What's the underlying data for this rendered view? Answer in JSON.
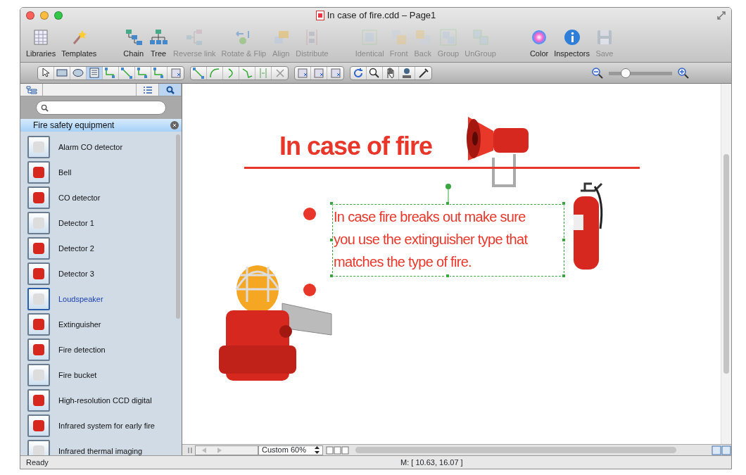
{
  "window": {
    "title": "In case of fire.cdd – Page1"
  },
  "toolbar": [
    {
      "label": "Libraries",
      "kind": "libraries",
      "enabled": true
    },
    {
      "label": "Templates",
      "kind": "templates",
      "enabled": true
    },
    {
      "label": "Chain",
      "kind": "chain",
      "enabled": true
    },
    {
      "label": "Tree",
      "kind": "tree",
      "enabled": true
    },
    {
      "label": "Reverse link",
      "kind": "reverse",
      "enabled": false
    },
    {
      "label": "Rotate & Flip",
      "kind": "rotate",
      "enabled": false
    },
    {
      "label": "Align",
      "kind": "align",
      "enabled": false
    },
    {
      "label": "Distribute",
      "kind": "distribute",
      "enabled": false
    },
    {
      "label": "Identical",
      "kind": "identical",
      "enabled": false
    },
    {
      "label": "Front",
      "kind": "front",
      "enabled": false
    },
    {
      "label": "Back",
      "kind": "back",
      "enabled": false
    },
    {
      "label": "Group",
      "kind": "group",
      "enabled": false
    },
    {
      "label": "UnGroup",
      "kind": "ungroup",
      "enabled": false
    },
    {
      "label": "Color",
      "kind": "color",
      "enabled": true
    },
    {
      "label": "Inspectors",
      "kind": "info",
      "enabled": true
    },
    {
      "label": "Save",
      "kind": "save",
      "enabled": false
    }
  ],
  "tool_groups": [
    [
      {
        "kind": "pointer",
        "selected": false
      },
      {
        "kind": "rect",
        "selected": false
      },
      {
        "kind": "ellipse",
        "selected": false
      },
      {
        "kind": "text",
        "selected": true
      },
      {
        "kind": "connector",
        "selected": false
      },
      {
        "kind": "line",
        "selected": false
      },
      {
        "kind": "connector",
        "selected": false
      },
      {
        "kind": "connector",
        "selected": false
      },
      {
        "kind": "insert",
        "selected": false
      }
    ],
    [
      {
        "kind": "line",
        "selected": false
      },
      {
        "kind": "arc",
        "selected": false
      },
      {
        "kind": "curve",
        "selected": false
      },
      {
        "kind": "polyline",
        "selected": false
      },
      {
        "kind": "split",
        "selected": false
      },
      {
        "kind": "cut",
        "selected": false
      }
    ],
    [
      {
        "kind": "insert",
        "selected": false
      },
      {
        "kind": "insert",
        "selected": false
      },
      {
        "kind": "insert",
        "selected": false
      }
    ],
    [
      {
        "kind": "refresh",
        "selected": false
      },
      {
        "kind": "zoom",
        "selected": false
      },
      {
        "kind": "hand",
        "selected": false
      },
      {
        "kind": "stamp",
        "selected": false
      },
      {
        "kind": "dropper",
        "selected": false
      }
    ]
  ],
  "zoom_slider": {
    "level": 0.27
  },
  "sidebar": {
    "library": "Fire safety equipment",
    "items": [
      {
        "label": "Alarm CO detector",
        "selected": false
      },
      {
        "label": "Bell",
        "selected": false
      },
      {
        "label": "CO detector",
        "selected": false
      },
      {
        "label": "Detector 1",
        "selected": false
      },
      {
        "label": "Detector 2",
        "selected": false
      },
      {
        "label": "Detector 3",
        "selected": false
      },
      {
        "label": "Loudspeaker",
        "selected": true
      },
      {
        "label": "Extinguisher",
        "selected": false
      },
      {
        "label": "Fire detection",
        "selected": false
      },
      {
        "label": "Fire bucket",
        "selected": false
      },
      {
        "label": "High-resolution CCD digital",
        "selected": false
      },
      {
        "label": "Infrared system for early fire",
        "selected": false
      },
      {
        "label": "Infrared thermal imaging",
        "selected": false
      }
    ]
  },
  "canvas": {
    "title": "In case of fire",
    "text_block": {
      "text": "In case fire breaks out make sure you use the extinguisher type that matches the type of fire.",
      "selected": true
    }
  },
  "zoom_select": {
    "value": "Custom 60%"
  },
  "status_bar": {
    "left": "Ready",
    "coordinates": "M: [ 10.63, 16.07 ]"
  }
}
